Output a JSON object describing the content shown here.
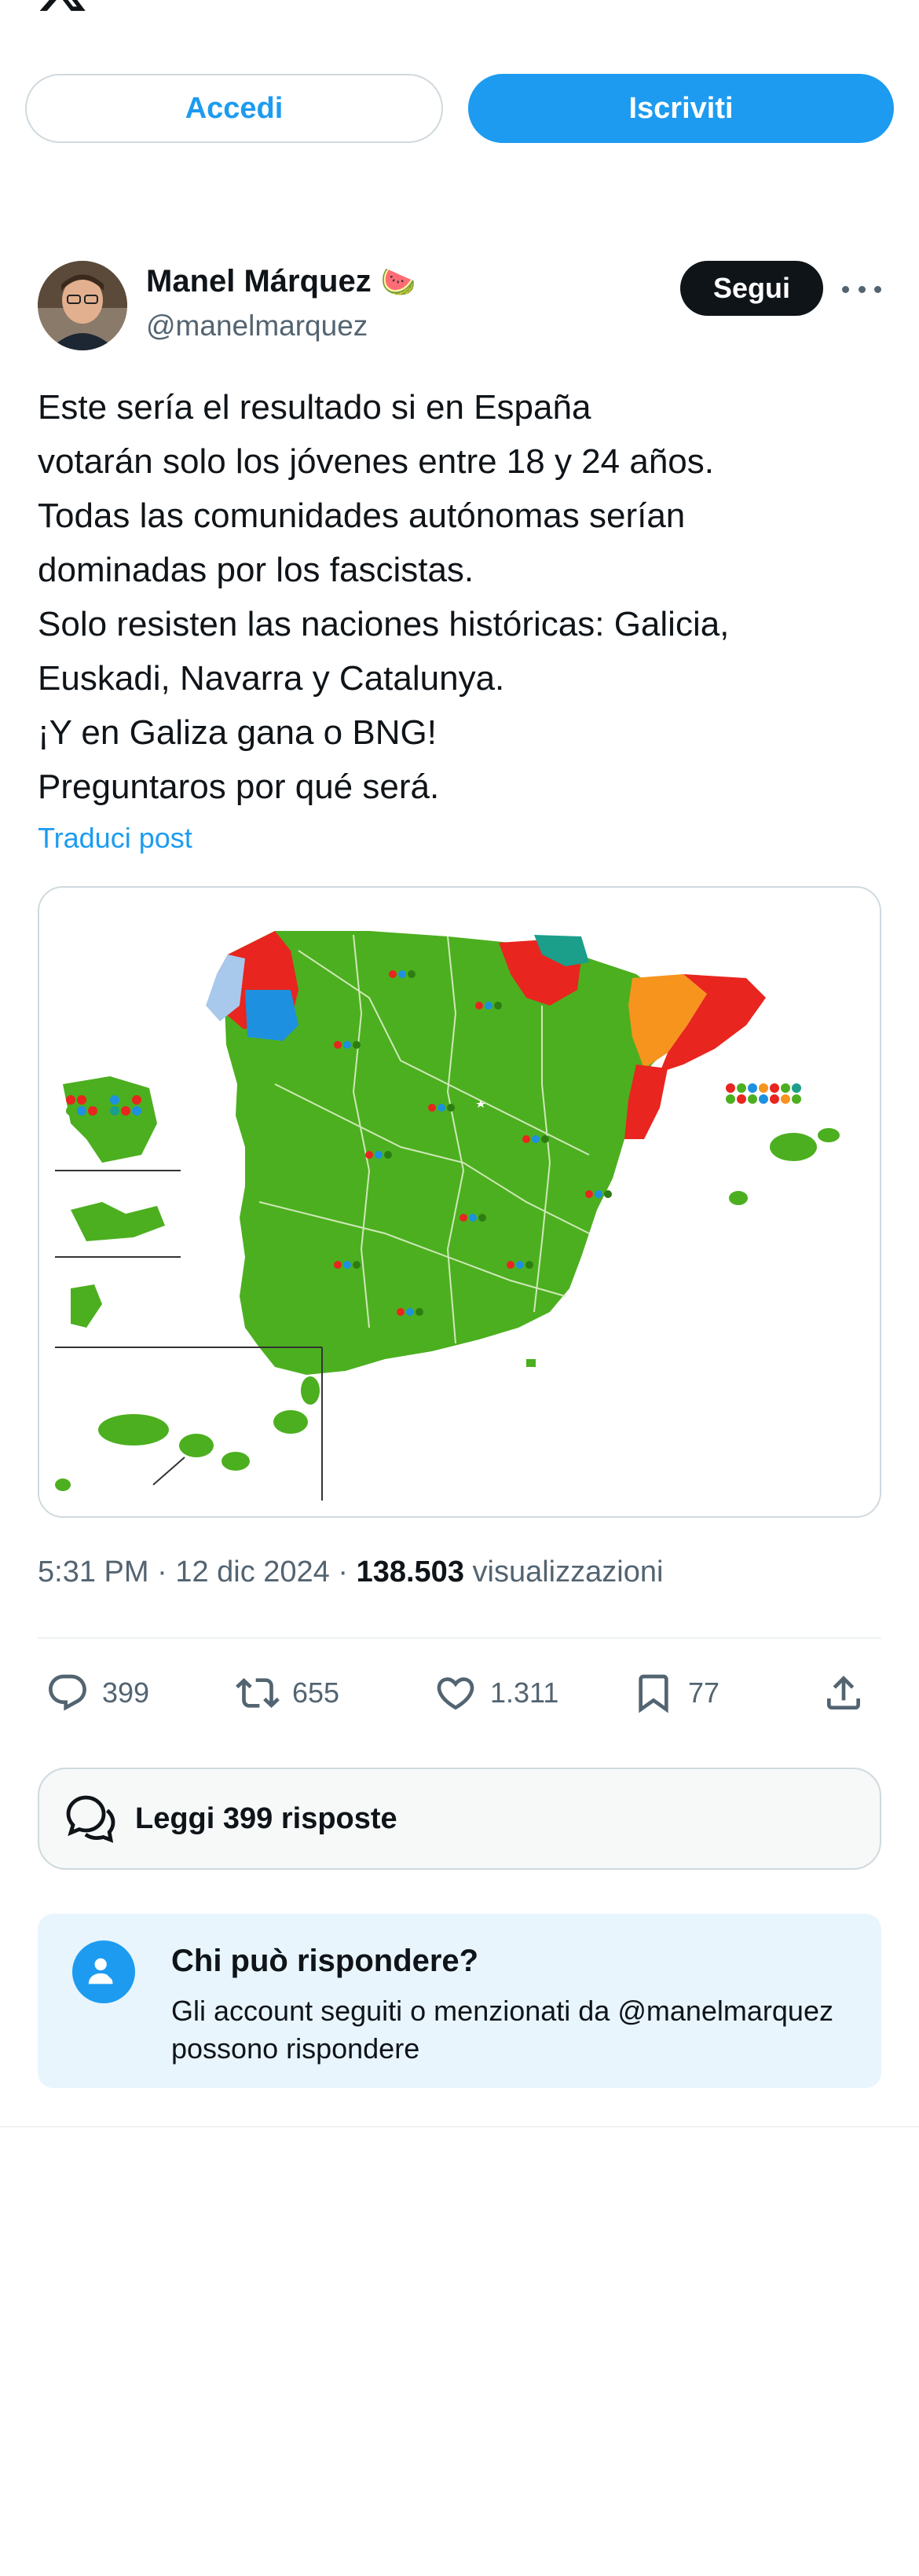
{
  "header": {
    "login_label": "Accedi",
    "signup_label": "Iscriviti"
  },
  "author": {
    "display_name": "Manel Márquez",
    "name_emoji": "🍉",
    "handle": "@manelmarquez",
    "follow_label": "Segui"
  },
  "tweet": {
    "lines": [
      "Este sería el resultado si en España",
      "votarán solo los jóvenes entre 18 y 24 años.",
      "Todas las comunidades autónomas serían",
      "dominadas por los fascistas.",
      "Solo resisten las naciones históricas: Galicia,",
      "Euskadi, Navarra y Catalunya.",
      "¡Y en Galiza gana o BNG!",
      "Preguntaros por qué será."
    ],
    "translate_label": "Traduci post",
    "time": "5:31 PM",
    "date": "12 dic 2024",
    "views_count": "138.503",
    "views_label": "visualizzazioni"
  },
  "actions": {
    "replies": "399",
    "reposts": "655",
    "likes": "1.311",
    "bookmarks": "77"
  },
  "read_replies_label": "Leggi 399 risposte",
  "who_can_reply": {
    "title": "Chi può rispondere?",
    "description": "Gli account seguiti o menzionati da @manelmarquez possono rispondere"
  },
  "colors": {
    "accent": "#1d9bf0",
    "map_green": "#4caf1f",
    "map_red": "#e8251e",
    "map_orange": "#f7941d",
    "map_blue": "#1e90e0",
    "map_teal": "#1b9e8a"
  }
}
